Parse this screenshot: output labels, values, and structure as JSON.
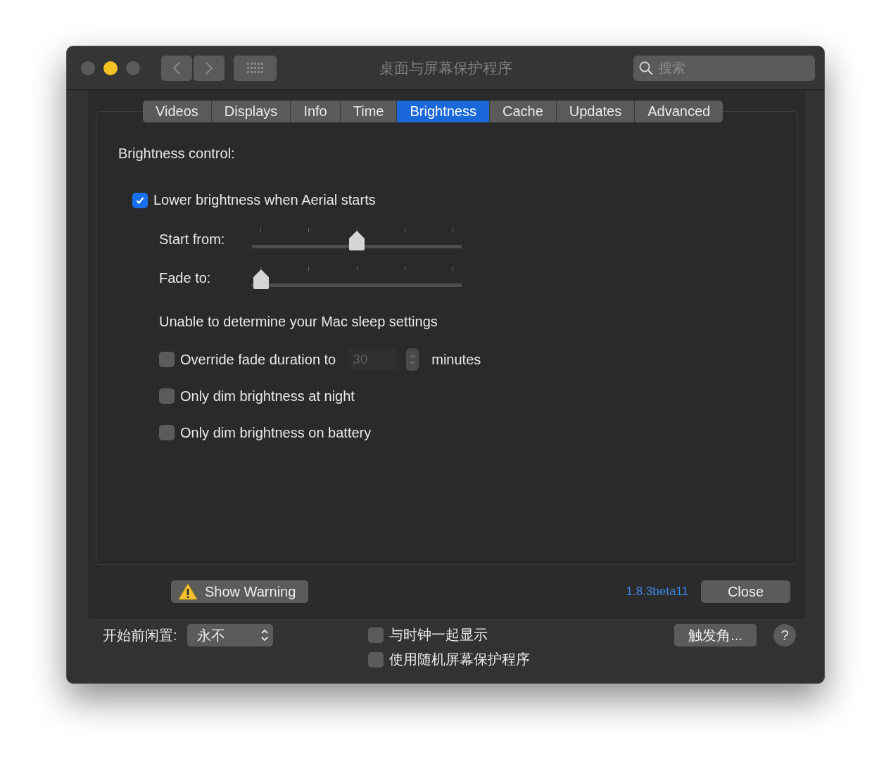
{
  "window": {
    "title": "桌面与屏幕保护程序"
  },
  "search": {
    "placeholder": "搜索"
  },
  "tabs": [
    {
      "label": "Videos",
      "selected": false
    },
    {
      "label": "Displays",
      "selected": false
    },
    {
      "label": "Info",
      "selected": false
    },
    {
      "label": "Time",
      "selected": false
    },
    {
      "label": "Brightness",
      "selected": true
    },
    {
      "label": "Cache",
      "selected": false
    },
    {
      "label": "Updates",
      "selected": false
    },
    {
      "label": "Advanced",
      "selected": false
    }
  ],
  "section_label": "Brightness control:",
  "lower_brightness": {
    "label": "Lower brightness when Aerial starts",
    "checked": true
  },
  "sliders": [
    {
      "label": "Start from:",
      "level": 0.5
    },
    {
      "label": "Fade to:",
      "level": 0
    }
  ],
  "sleep_message": "Unable to determine your Mac sleep settings",
  "override": {
    "label": "Override fade duration to",
    "checked": false,
    "value": "30",
    "unit": "minutes"
  },
  "options": [
    {
      "label": "Only dim brightness at night",
      "checked": false
    },
    {
      "label": "Only dim brightness on battery",
      "checked": false
    }
  ],
  "show_warning": "Show Warning",
  "version": "1.8.3beta11",
  "close": "Close",
  "idle": {
    "label": "开始前闲置:",
    "value": "永不"
  },
  "bottom_options": [
    {
      "label": "与时钟一起显示",
      "checked": false
    },
    {
      "label": "使用随机屏幕保护程序",
      "checked": false
    }
  ],
  "hot_corners": "触发角...",
  "help": "?"
}
